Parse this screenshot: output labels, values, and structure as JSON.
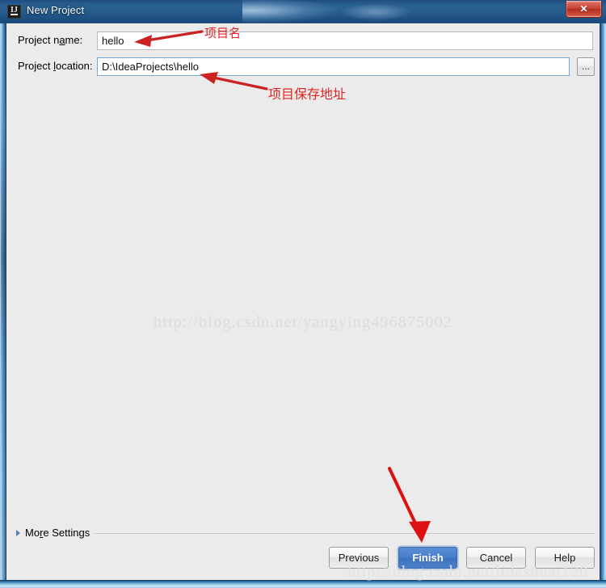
{
  "window": {
    "title": "New Project",
    "app_icon": "intellij-idea-icon",
    "close_label": "✕",
    "titlebar_color": "#1b4a7c",
    "close_button_color": "#c33f32"
  },
  "form": {
    "fields": [
      {
        "id": "project-name",
        "label_before": "Project n",
        "label_mnemonic": "a",
        "label_after": "me:",
        "label_full": "Project name:",
        "value": "hello",
        "placeholder": ""
      },
      {
        "id": "project-location",
        "label_before": "Project ",
        "label_mnemonic": "l",
        "label_after": "ocation:",
        "label_full": "Project location:",
        "value": "D:\\IdeaProjects\\hello",
        "placeholder": ""
      }
    ],
    "browse_button": {
      "label": "...",
      "icon": "ellipsis-icon"
    }
  },
  "more_settings": {
    "label_before": "Mo",
    "label_mnemonic": "r",
    "label_after": "e Settings",
    "label_full": "More Settings",
    "expanded": false,
    "arrow_icon": "chevron-right-icon"
  },
  "buttons": [
    {
      "id": "previous",
      "label": "Previous",
      "primary": false
    },
    {
      "id": "finish",
      "label": "Finish",
      "primary": true
    },
    {
      "id": "cancel",
      "label": "Cancel",
      "primary": false
    },
    {
      "id": "help",
      "label": "Help",
      "primary": false
    }
  ],
  "watermarks": {
    "center": "http://blog.csdn.net/yangying496875002",
    "bottom": "http://blog.csdn.net/lidashuai120"
  },
  "annotations": {
    "accent_color": "#e02222",
    "project_name_note": "项目名",
    "project_location_note": "项目保存地址"
  }
}
